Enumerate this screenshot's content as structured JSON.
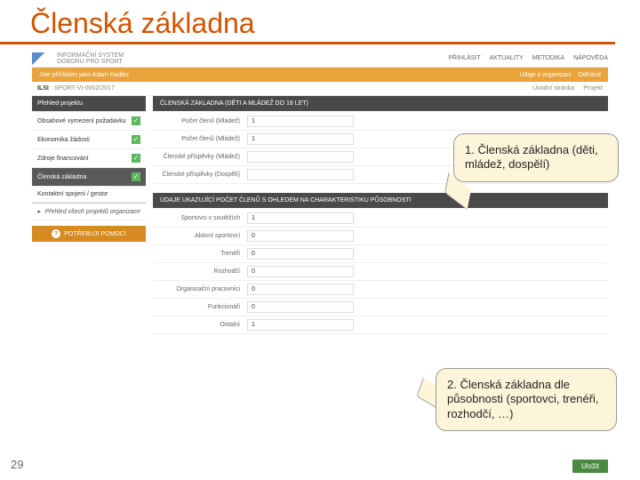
{
  "slide": {
    "title": "Členská základna",
    "pageNumber": "29"
  },
  "topbar": {
    "logoText1": "INFORMAČNÍ SYSTÉM",
    "logoText2": "DOBORU PRO SPORT",
    "nav": [
      "PŘIHLÁSIT",
      "AKTUALITY",
      "METODIKA",
      "NÁPOVĚDA"
    ]
  },
  "userbar": {
    "left": "Jste přihlášen jako Adam Kadlec",
    "rightItems": [
      "Údaje o organizaci",
      "Odhlásit"
    ]
  },
  "crumb": {
    "brand": "ILSI",
    "code": "SPORT-VI-0002/2017",
    "rightItems": [
      "Úvodní stránka",
      "Projekt"
    ]
  },
  "sidebar": {
    "header": "Přehled projektu",
    "items": [
      {
        "label": "Obsahové vymezení požadavku",
        "checked": true
      },
      {
        "label": "Ekonomika žádosti",
        "checked": true
      },
      {
        "label": "Zdroje financování",
        "checked": true
      },
      {
        "label": "Členská základna",
        "checked": true,
        "selected": true
      },
      {
        "label": "Kontaktní spojení / gestor",
        "checked": false
      }
    ],
    "footer": "Přehled všech projektů organizace",
    "help": "POTŘEBUJI POMOC!"
  },
  "section1": {
    "header": "ČLENSKÁ ZÁKLADNA (DĚTI A MLÁDEŽ DO 18 LET)",
    "rows": [
      {
        "lbl": "Počet členů (Mládež)",
        "val": "1"
      },
      {
        "lbl": "Počet členů (Mládež)",
        "val": "1"
      },
      {
        "lbl": "Členské příspěvky (Mládež)",
        "val": ""
      },
      {
        "lbl": "Členské příspěvky (Dospělí)",
        "val": ""
      }
    ]
  },
  "section2": {
    "header": "ÚDAJE UKAZUJÍCÍ POČET ČLENŮ S OHLEDEM NA CHARAKTERISTIKU PŮSOBNOSTI",
    "rows": [
      {
        "lbl": "Sportovci v soutěžích",
        "val": "1"
      },
      {
        "lbl": "Aktivní sportovci",
        "val": "0"
      },
      {
        "lbl": "Trenéři",
        "val": "0"
      },
      {
        "lbl": "Rozhodčí",
        "val": "0"
      },
      {
        "lbl": "Organizační pracovníci",
        "val": "0"
      },
      {
        "lbl": "Funkcionáři",
        "val": "0"
      },
      {
        "lbl": "Ostatní",
        "val": "1"
      }
    ]
  },
  "callouts": {
    "c1": "1. Členská základna (děti, mládež, dospělí)",
    "c2": "2. Členská základna dle působnosti (sportovci, trenéři, rozhodčí, …)"
  },
  "actions": {
    "save": "Uložit"
  }
}
